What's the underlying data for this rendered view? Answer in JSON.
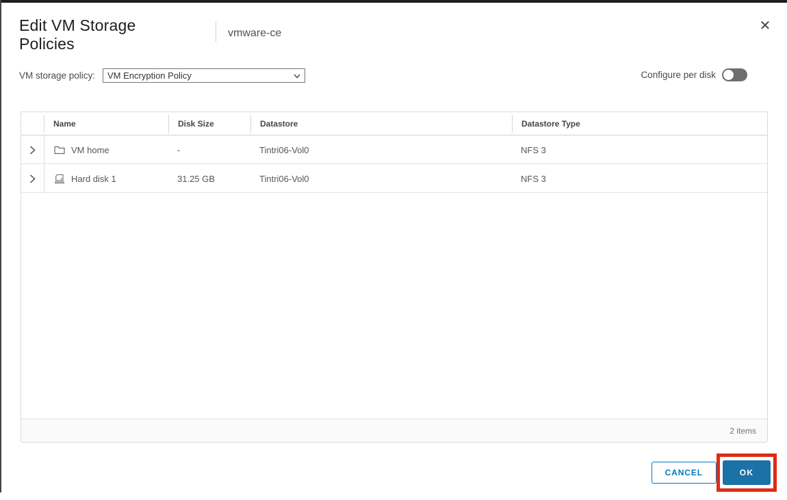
{
  "dialog": {
    "title": "Edit VM Storage Policies",
    "subtitle": "vmware-ce",
    "close_glyph": "✕"
  },
  "policy_form": {
    "label": "VM storage policy:",
    "selected_option": "VM Encryption Policy",
    "configure_per_disk_label": "Configure per disk",
    "configure_per_disk_enabled": false
  },
  "table": {
    "columns": [
      "Name",
      "Disk Size",
      "Datastore",
      "Datastore Type"
    ],
    "rows": [
      {
        "icon": "folder-icon",
        "name": "VM home",
        "disk_size": "-",
        "datastore": "Tintri06-Vol0",
        "datastore_type": "NFS 3"
      },
      {
        "icon": "hard-disk-icon",
        "name": "Hard disk 1",
        "disk_size": "31.25 GB",
        "datastore": "Tintri06-Vol0",
        "datastore_type": "NFS 3"
      }
    ],
    "footer_count": "2 items"
  },
  "actions": {
    "cancel_label": "CANCEL",
    "ok_label": "OK"
  },
  "colors": {
    "primary_blue": "#1b72a6",
    "outline_blue": "#0079b8",
    "annotation_red": "#de2b16",
    "toggle_off": "#6e6e6e"
  }
}
